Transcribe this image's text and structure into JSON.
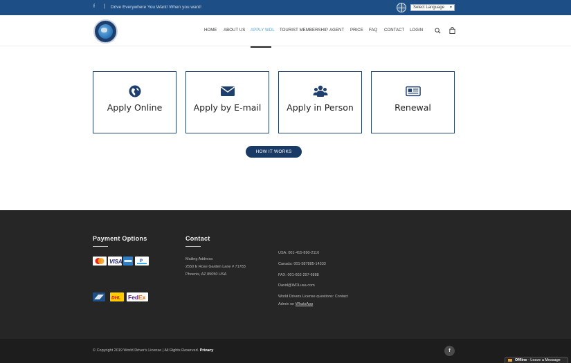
{
  "topbar": {
    "facebook": "f",
    "separator": "|",
    "tagline": "Drive Everywhere You Want! When you want!",
    "language_select": "Select Language"
  },
  "nav": {
    "items": [
      {
        "label": "HOME"
      },
      {
        "label": "ABOUT US"
      },
      {
        "label": "APPLY WDL"
      },
      {
        "label": "TOURIST MEMBERSHIP"
      },
      {
        "label": "AGENT"
      },
      {
        "label": "PRICE"
      },
      {
        "label": "FAQ"
      },
      {
        "label": "CONTACT"
      },
      {
        "label": "LOGIN"
      }
    ],
    "active": "APPLY WDL"
  },
  "cards": [
    {
      "title": "Apply Online",
      "icon": "globe-icon"
    },
    {
      "title": "Apply by E-mail",
      "icon": "envelope-icon"
    },
    {
      "title": "Apply in Person",
      "icon": "users-icon"
    },
    {
      "title": "Renewal",
      "icon": "newspaper-icon"
    }
  ],
  "how_it_works": "HOW IT WORKS",
  "footer": {
    "payment_heading": "Payment Options",
    "contact_heading": "Contact",
    "mailing": {
      "label": "Mailing Address:",
      "line1": "2550 E Rose Garden Lane # 71783",
      "line2": "Phoenix, AZ 85050 USA"
    },
    "phones": {
      "usa": "USA: 001-415-890-2116",
      "canada": "Canada: 001-587885-14333",
      "fax": "FAX: 001-602-297-6888",
      "email": "David@WDLusa.com",
      "questions": "World Drivers License questions: Contact",
      "admin_prefix": "Admin on ",
      "whatsapp": "WhatsApp"
    },
    "copyright": "© Copyright 2019 World Driver's License | All Rights Reserved.",
    "privacy": "Privacy",
    "social": "f",
    "chat": {
      "status": "Offline",
      "message": " - Leave a Message"
    }
  },
  "colors": {
    "topbar": "#1d4f86",
    "accent": "#4aa3d8",
    "button": "#1a3a66",
    "footer": "#262626"
  }
}
